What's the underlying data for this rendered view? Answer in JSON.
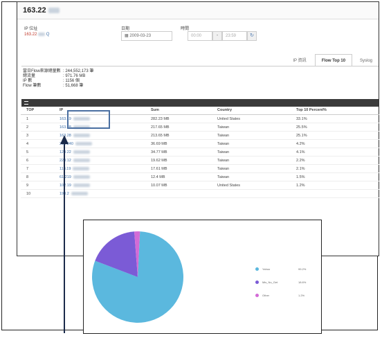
{
  "header": {
    "ip_title": "163.22"
  },
  "form": {
    "ip_label": "IP 位址",
    "ip_value": "163.22",
    "date_label": "日期",
    "date_value": "2009-03-23",
    "time_label": "時間",
    "time_from": "00:00",
    "time_sep": "-",
    "time_to": "23:59"
  },
  "tabs": [
    {
      "label": "IP 資訊",
      "active": false
    },
    {
      "label": "Flow Top 10",
      "active": true
    },
    {
      "label": "Syslog",
      "active": false
    }
  ],
  "stats": [
    {
      "label": "當日Flow來源總量數",
      "value": ": 244,552,173 筆"
    },
    {
      "label": "總流量",
      "value": ": 971.76 MB"
    },
    {
      "label": "IP 數",
      "value": ": 1156 個"
    },
    {
      "label": "Flow 筆數",
      "value": ": 51,668 筆"
    }
  ],
  "table": {
    "columns": [
      "TOP",
      "IP",
      "Sum",
      "Country",
      "Top 10 Percent%"
    ],
    "rows": [
      [
        "1",
        "163.19",
        "282.23 MB",
        "United States",
        "33.1%"
      ],
      [
        "2",
        "163.28",
        "217.65 MB",
        "Taiwan",
        "25.5%"
      ],
      [
        "3",
        "163.28",
        "213.65 MB",
        "Taiwan",
        "25.1%"
      ],
      [
        "4",
        "210.240",
        "36.69 MB",
        "Taiwan",
        "4.2%"
      ],
      [
        "5",
        "120.22",
        "34.77 MB",
        "Taiwan",
        "4.1%"
      ],
      [
        "6",
        "220.12",
        "19.62 MB",
        "Taiwan",
        "2.2%"
      ],
      [
        "7",
        "118.19",
        "17.61 MB",
        "Taiwan",
        "2.1%"
      ],
      [
        "8",
        "61.219",
        "12.4 MB",
        "Taiwan",
        "1.5%"
      ],
      [
        "9",
        "102.19",
        "10.07 MB",
        "United States",
        "1.2%"
      ],
      [
        "10",
        "198.2",
        "",
        "",
        ""
      ]
    ]
  },
  "pie": {
    "legend": [
      {
        "label": "Yahoo",
        "value": "99.2%",
        "color": "#5bb8de"
      },
      {
        "label": "Mis_No_Get",
        "value": "18.6%",
        "color": "#7b5bd6"
      },
      {
        "label": "Other",
        "value": "1.2%",
        "color": "#d36bd6"
      }
    ]
  }
}
